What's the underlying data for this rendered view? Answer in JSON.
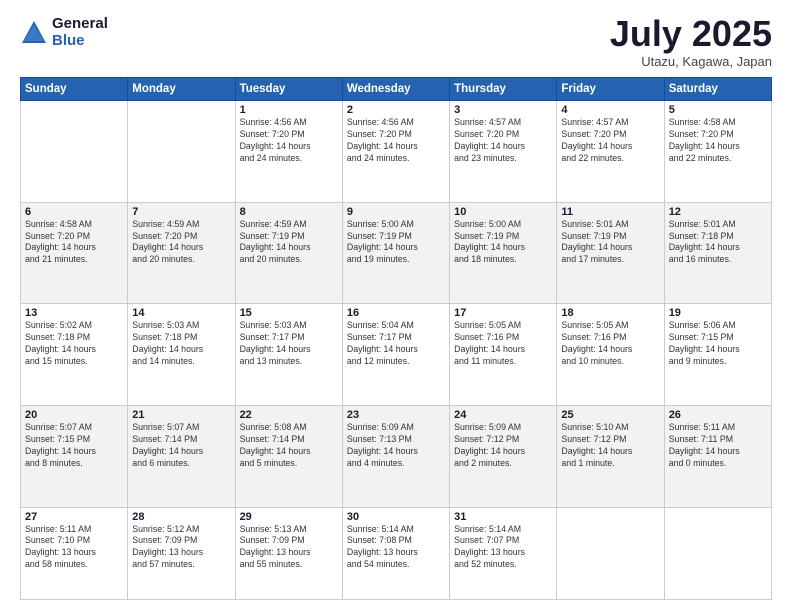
{
  "logo": {
    "general": "General",
    "blue": "Blue"
  },
  "header": {
    "month": "July 2025",
    "location": "Utazu, Kagawa, Japan"
  },
  "weekdays": [
    "Sunday",
    "Monday",
    "Tuesday",
    "Wednesday",
    "Thursday",
    "Friday",
    "Saturday"
  ],
  "weeks": [
    [
      {
        "day": "",
        "info": ""
      },
      {
        "day": "",
        "info": ""
      },
      {
        "day": "1",
        "info": "Sunrise: 4:56 AM\nSunset: 7:20 PM\nDaylight: 14 hours\nand 24 minutes."
      },
      {
        "day": "2",
        "info": "Sunrise: 4:56 AM\nSunset: 7:20 PM\nDaylight: 14 hours\nand 24 minutes."
      },
      {
        "day": "3",
        "info": "Sunrise: 4:57 AM\nSunset: 7:20 PM\nDaylight: 14 hours\nand 23 minutes."
      },
      {
        "day": "4",
        "info": "Sunrise: 4:57 AM\nSunset: 7:20 PM\nDaylight: 14 hours\nand 22 minutes."
      },
      {
        "day": "5",
        "info": "Sunrise: 4:58 AM\nSunset: 7:20 PM\nDaylight: 14 hours\nand 22 minutes."
      }
    ],
    [
      {
        "day": "6",
        "info": "Sunrise: 4:58 AM\nSunset: 7:20 PM\nDaylight: 14 hours\nand 21 minutes."
      },
      {
        "day": "7",
        "info": "Sunrise: 4:59 AM\nSunset: 7:20 PM\nDaylight: 14 hours\nand 20 minutes."
      },
      {
        "day": "8",
        "info": "Sunrise: 4:59 AM\nSunset: 7:19 PM\nDaylight: 14 hours\nand 20 minutes."
      },
      {
        "day": "9",
        "info": "Sunrise: 5:00 AM\nSunset: 7:19 PM\nDaylight: 14 hours\nand 19 minutes."
      },
      {
        "day": "10",
        "info": "Sunrise: 5:00 AM\nSunset: 7:19 PM\nDaylight: 14 hours\nand 18 minutes."
      },
      {
        "day": "11",
        "info": "Sunrise: 5:01 AM\nSunset: 7:19 PM\nDaylight: 14 hours\nand 17 minutes."
      },
      {
        "day": "12",
        "info": "Sunrise: 5:01 AM\nSunset: 7:18 PM\nDaylight: 14 hours\nand 16 minutes."
      }
    ],
    [
      {
        "day": "13",
        "info": "Sunrise: 5:02 AM\nSunset: 7:18 PM\nDaylight: 14 hours\nand 15 minutes."
      },
      {
        "day": "14",
        "info": "Sunrise: 5:03 AM\nSunset: 7:18 PM\nDaylight: 14 hours\nand 14 minutes."
      },
      {
        "day": "15",
        "info": "Sunrise: 5:03 AM\nSunset: 7:17 PM\nDaylight: 14 hours\nand 13 minutes."
      },
      {
        "day": "16",
        "info": "Sunrise: 5:04 AM\nSunset: 7:17 PM\nDaylight: 14 hours\nand 12 minutes."
      },
      {
        "day": "17",
        "info": "Sunrise: 5:05 AM\nSunset: 7:16 PM\nDaylight: 14 hours\nand 11 minutes."
      },
      {
        "day": "18",
        "info": "Sunrise: 5:05 AM\nSunset: 7:16 PM\nDaylight: 14 hours\nand 10 minutes."
      },
      {
        "day": "19",
        "info": "Sunrise: 5:06 AM\nSunset: 7:15 PM\nDaylight: 14 hours\nand 9 minutes."
      }
    ],
    [
      {
        "day": "20",
        "info": "Sunrise: 5:07 AM\nSunset: 7:15 PM\nDaylight: 14 hours\nand 8 minutes."
      },
      {
        "day": "21",
        "info": "Sunrise: 5:07 AM\nSunset: 7:14 PM\nDaylight: 14 hours\nand 6 minutes."
      },
      {
        "day": "22",
        "info": "Sunrise: 5:08 AM\nSunset: 7:14 PM\nDaylight: 14 hours\nand 5 minutes."
      },
      {
        "day": "23",
        "info": "Sunrise: 5:09 AM\nSunset: 7:13 PM\nDaylight: 14 hours\nand 4 minutes."
      },
      {
        "day": "24",
        "info": "Sunrise: 5:09 AM\nSunset: 7:12 PM\nDaylight: 14 hours\nand 2 minutes."
      },
      {
        "day": "25",
        "info": "Sunrise: 5:10 AM\nSunset: 7:12 PM\nDaylight: 14 hours\nand 1 minute."
      },
      {
        "day": "26",
        "info": "Sunrise: 5:11 AM\nSunset: 7:11 PM\nDaylight: 14 hours\nand 0 minutes."
      }
    ],
    [
      {
        "day": "27",
        "info": "Sunrise: 5:11 AM\nSunset: 7:10 PM\nDaylight: 13 hours\nand 58 minutes."
      },
      {
        "day": "28",
        "info": "Sunrise: 5:12 AM\nSunset: 7:09 PM\nDaylight: 13 hours\nand 57 minutes."
      },
      {
        "day": "29",
        "info": "Sunrise: 5:13 AM\nSunset: 7:09 PM\nDaylight: 13 hours\nand 55 minutes."
      },
      {
        "day": "30",
        "info": "Sunrise: 5:14 AM\nSunset: 7:08 PM\nDaylight: 13 hours\nand 54 minutes."
      },
      {
        "day": "31",
        "info": "Sunrise: 5:14 AM\nSunset: 7:07 PM\nDaylight: 13 hours\nand 52 minutes."
      },
      {
        "day": "",
        "info": ""
      },
      {
        "day": "",
        "info": ""
      }
    ]
  ]
}
